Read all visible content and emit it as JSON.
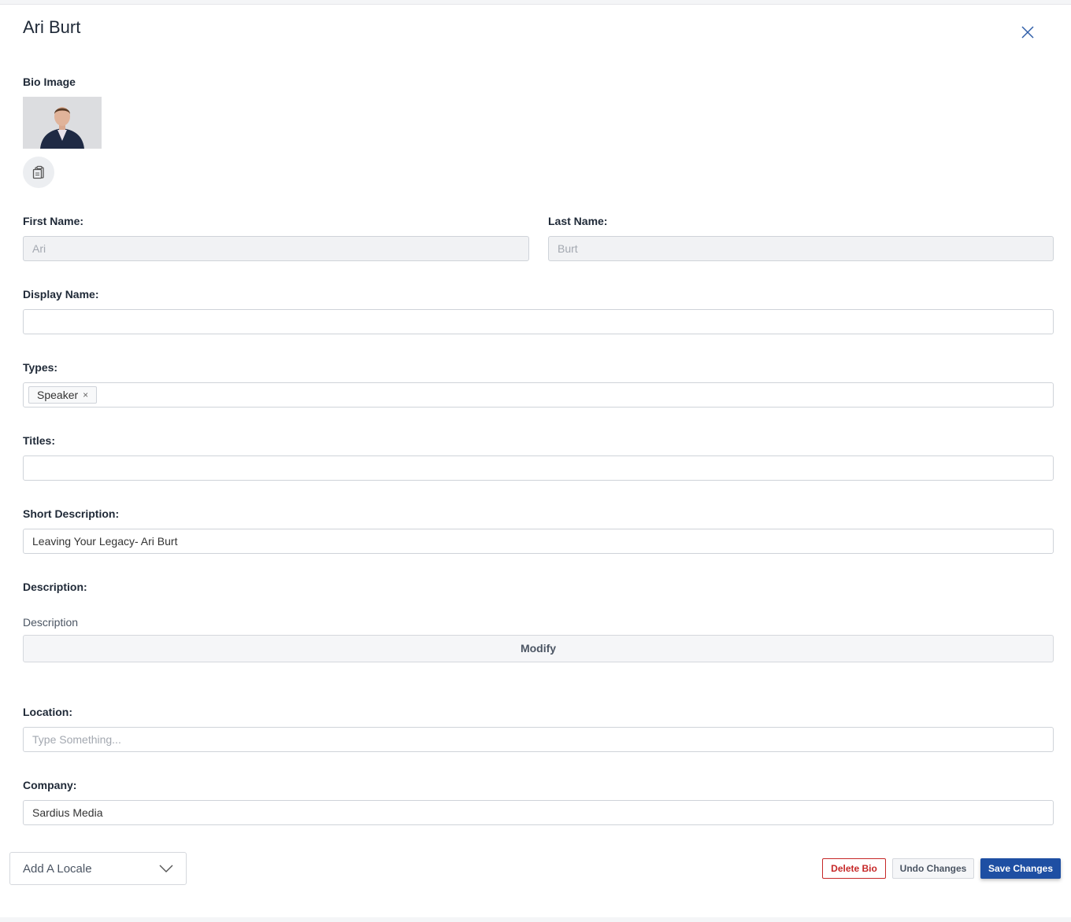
{
  "modal": {
    "title": "Ari Burt"
  },
  "bio_image": {
    "label": "Bio Image"
  },
  "fields": {
    "first_name": {
      "label": "First Name:",
      "value": "Ari"
    },
    "last_name": {
      "label": "Last Name:",
      "value": "Burt"
    },
    "display_name": {
      "label": "Display Name:",
      "value": ""
    },
    "types": {
      "label": "Types:",
      "tags": [
        "Speaker"
      ]
    },
    "titles": {
      "label": "Titles:",
      "value": ""
    },
    "short_description": {
      "label": "Short Description:",
      "value": "Leaving Your Legacy- Ari Burt"
    },
    "description": {
      "label": "Description:",
      "sublabel": "Description",
      "button": "Modify"
    },
    "location": {
      "label": "Location:",
      "value": "",
      "placeholder": "Type Something..."
    },
    "company": {
      "label": "Company:",
      "value": "Sardius Media"
    }
  },
  "footer": {
    "locale_placeholder": "Add A Locale",
    "delete_label": "Delete Bio",
    "undo_label": "Undo Changes",
    "save_label": "Save Changes"
  },
  "colors": {
    "primary": "#1e4fa3",
    "danger": "#c62828",
    "close_icon": "#2f5ea8"
  }
}
